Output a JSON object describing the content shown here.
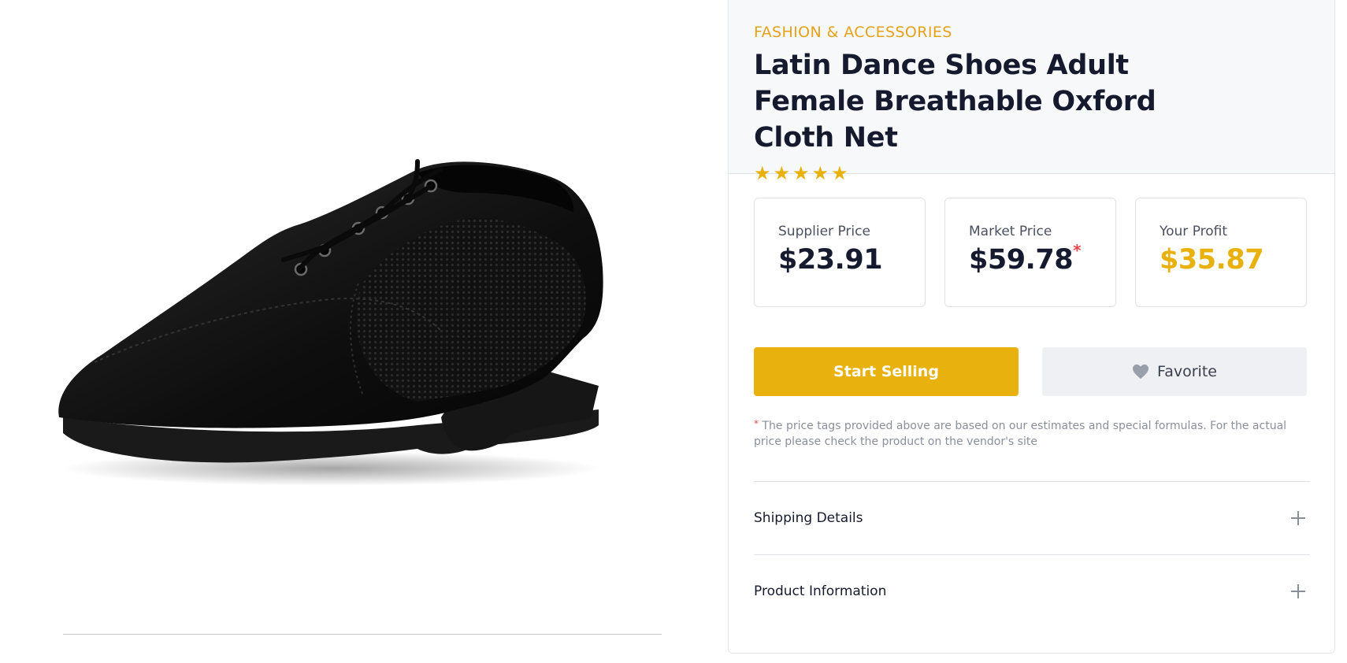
{
  "product": {
    "category": "FASHION & ACCESSORIES",
    "title": "Latin Dance Shoes Adult Female Breathable Oxford Cloth Net",
    "rating": 5,
    "rating_stars": "★★★★★",
    "image_icon": "shoe-image"
  },
  "prices": {
    "supplier": {
      "label": "Supplier Price",
      "value": "$23.91"
    },
    "market": {
      "label": "Market Price",
      "value": "$59.78",
      "mark": "*"
    },
    "profit": {
      "label": "Your Profit",
      "value": "$35.87"
    }
  },
  "actions": {
    "start_selling": "Start Selling",
    "favorite": "Favorite"
  },
  "disclaimer": {
    "mark": "*",
    "text": "The price tags provided above are based on our estimates and special formulas. For the actual price please check the product on the vendor's site"
  },
  "accordion": {
    "shipping": "Shipping Details",
    "product_info": "Product Information"
  },
  "colors": {
    "accent": "#e8b10d",
    "category": "#e6a11a",
    "title": "#161a2e",
    "required_mark": "#e8474a"
  },
  "icons": {
    "favorite": "heart-icon",
    "expand": "plus-icon",
    "rating": "star-icon"
  }
}
